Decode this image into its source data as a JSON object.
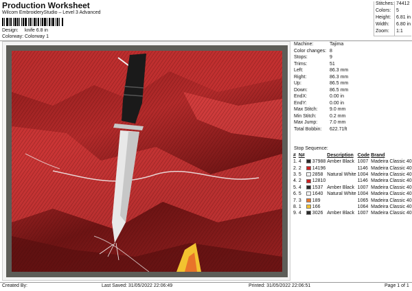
{
  "header": {
    "title": "Production Worksheet",
    "subtitle": "Wilcom EmbroideryStudio – Level 3 Advanced",
    "design_label": "Design:",
    "design_value": "knife 6.8 in",
    "colorway_label": "Colorway:",
    "colorway_value": "Colorway 1"
  },
  "summary": [
    {
      "k": "Stitches:",
      "v": "74412"
    },
    {
      "k": "Colors:",
      "v": "5"
    },
    {
      "k": "Height:",
      "v": "6.81 in"
    },
    {
      "k": "Width:",
      "v": "6.80 in"
    },
    {
      "k": "Zoom:",
      "v": "1:1"
    }
  ],
  "specs": [
    {
      "k": "Machine:",
      "v": "Tajima"
    },
    {
      "k": "Color changes:",
      "v": "8"
    },
    {
      "k": "Stops:",
      "v": "9"
    },
    {
      "k": "Trims:",
      "v": "51"
    },
    {
      "k": "Left:",
      "v": "86.3 mm"
    },
    {
      "k": "Right:",
      "v": "86.3 mm"
    },
    {
      "k": "Up:",
      "v": "86.5 mm"
    },
    {
      "k": "Down:",
      "v": "86.5 mm"
    },
    {
      "k": "EndX:",
      "v": "0.00 in"
    },
    {
      "k": "EndY:",
      "v": "0.00 in"
    },
    {
      "k": "Max Stitch:",
      "v": "9.0 mm"
    },
    {
      "k": "Min Stitch:",
      "v": "0.2 mm"
    },
    {
      "k": "Max Jump:",
      "v": "7.0 mm"
    },
    {
      "k": "Total Bobbin:",
      "v": "622.71ft"
    }
  ],
  "stops": {
    "title": "Stop Sequence:",
    "headers": [
      "#",
      "N#",
      "",
      "",
      "Description",
      "Code",
      "Brand"
    ],
    "rows": [
      {
        "n": "1.",
        "num": "4",
        "color": "#2a2a2a",
        "stitches": "37988",
        "desc": "Amber Black",
        "code": "1007",
        "brand": "Madeira Classic 40"
      },
      {
        "n": "2.",
        "num": "2",
        "color": "#cc2222",
        "stitches": "14196",
        "desc": "",
        "code": "1146",
        "brand": "Madeira Classic 40"
      },
      {
        "n": "3.",
        "num": "5",
        "color": "#f2f2f2",
        "stitches": "2858",
        "desc": "Natural White",
        "code": "1004",
        "brand": "Madeira Classic 40"
      },
      {
        "n": "4.",
        "num": "2",
        "color": "#cc2222",
        "stitches": "12810",
        "desc": "",
        "code": "1146",
        "brand": "Madeira Classic 40"
      },
      {
        "n": "5.",
        "num": "4",
        "color": "#2a2a2a",
        "stitches": "1537",
        "desc": "Amber Black",
        "code": "1007",
        "brand": "Madeira Classic 40"
      },
      {
        "n": "6.",
        "num": "5",
        "color": "#f2f2f2",
        "stitches": "1640",
        "desc": "Natural White",
        "code": "1004",
        "brand": "Madeira Classic 40"
      },
      {
        "n": "7.",
        "num": "3",
        "color": "#e8742a",
        "stitches": "189",
        "desc": "",
        "code": "1065",
        "brand": "Madeira Classic 40"
      },
      {
        "n": "8.",
        "num": "1",
        "color": "#f2c230",
        "stitches": "166",
        "desc": "",
        "code": "1064",
        "brand": "Madeira Classic 40"
      },
      {
        "n": "9.",
        "num": "4",
        "color": "#2a2a2a",
        "stitches": "3026",
        "desc": "Amber Black",
        "code": "1007",
        "brand": "Madeira Classic 40"
      }
    ]
  },
  "footer": {
    "created": "Created By:",
    "last_saved": "Last Saved: 31/05/2022 22:06:49",
    "printed": "Printed: 31/05/2022 22:06:51",
    "page": "Page 1 of 1"
  }
}
